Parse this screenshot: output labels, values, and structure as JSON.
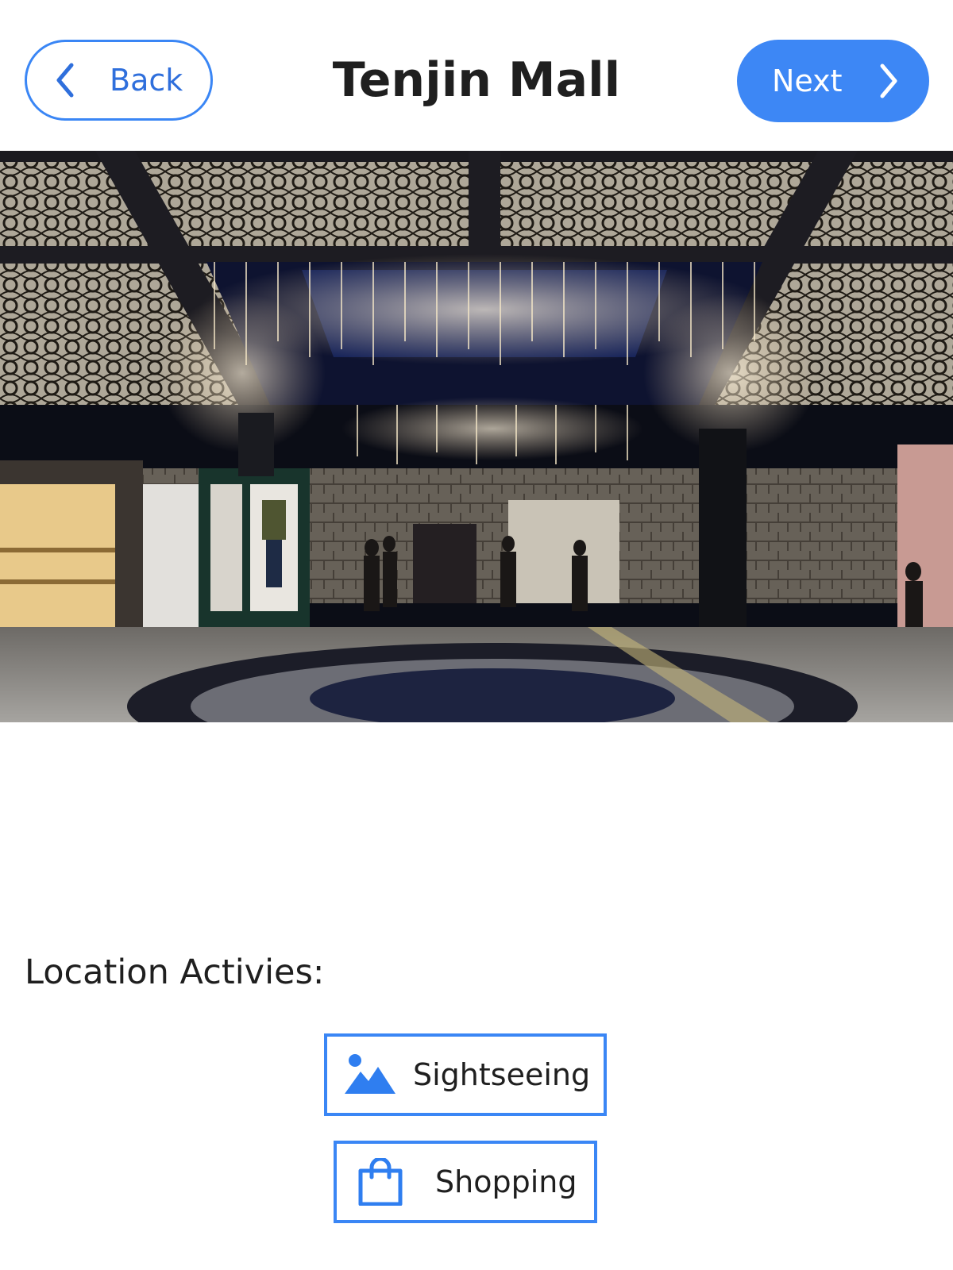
{
  "header": {
    "back_label": "Back",
    "title": "Tenjin Mall",
    "next_label": "Next"
  },
  "hero": {
    "description_icon": "photo-mall-interior"
  },
  "activities": {
    "label": "Location Activies:",
    "items": [
      {
        "label": "Sightseeing",
        "icon": "mountain-image-icon"
      },
      {
        "label": "Shopping",
        "icon": "shopping-bag-icon"
      }
    ]
  },
  "colors": {
    "accent": "#3a86f5",
    "text": "#1f1f1f"
  }
}
